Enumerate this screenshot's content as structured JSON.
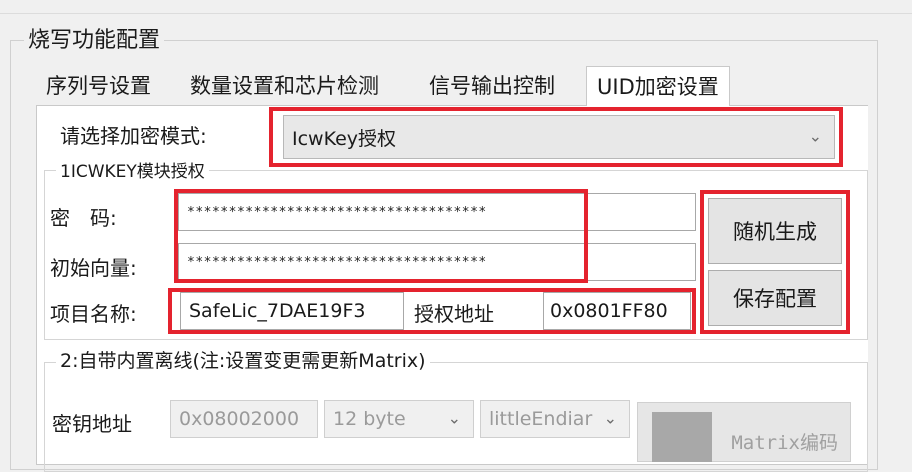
{
  "group": {
    "title": "烧写功能配置"
  },
  "tabs": [
    {
      "label": "序列号设置"
    },
    {
      "label": "数量设置和芯片检测"
    },
    {
      "label": "信号输出控制"
    },
    {
      "label": "UID加密设置"
    }
  ],
  "encrypt_mode": {
    "label": "请选择加密模式:",
    "value": "IcwKey授权"
  },
  "section1": {
    "title": "1ICWKEY模块授权",
    "password_label": "密　码:",
    "password_value": "************************************",
    "iv_label": "初始向量:",
    "iv_value": "************************************",
    "project_label": "项目名称:",
    "project_value": "SafeLic_7DAE19F3",
    "auth_addr_label": "授权地址",
    "auth_addr_value": "0x0801FF80"
  },
  "buttons": {
    "random": "随机生成",
    "save": "保存配置"
  },
  "section2": {
    "title": "2:自带内置离线(注:设置变更需更新Matrix)",
    "key_addr_label": "密钥地址",
    "key_addr_value": "0x08002000",
    "bytes_value": "12 byte",
    "endian_value": "littleEndiar",
    "matrix_button": "Matrix编码"
  }
}
